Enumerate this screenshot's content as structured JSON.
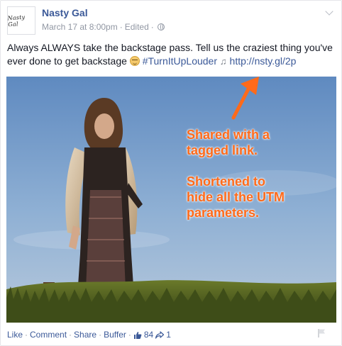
{
  "post": {
    "page_name": "Nasty Gal",
    "avatar_text": "Nasty Gal",
    "timestamp": "March 17 at 8:00pm",
    "edited_label": "Edited",
    "dot": "·",
    "text_main": "Always ALWAYS take the backstage pass. Tell us the craziest thing you've ever done to get backstage ",
    "hashtag": "#TurnItUpLouder",
    "music_note": "♫",
    "link": "http://nsty.gl/2p",
    "annotation": "Shared with a\ntagged link.\n\nShortened to\nhide all the UTM\nparameters."
  },
  "actions": {
    "like": "Like",
    "comment": "Comment",
    "share": "Share",
    "buffer": "Buffer",
    "likes_count": "84",
    "shares_count": "1",
    "sep": "·"
  },
  "icons": {
    "globe": "globe-icon",
    "chevron": "chevron-down-icon",
    "thumbs_up": "thumbs-up-icon",
    "share": "share-arrow-icon",
    "flag": "flag-icon",
    "emoji": "smiley-emoji-icon"
  },
  "colors": {
    "link": "#3b5998",
    "annotation": "#ff6a1a",
    "meta": "#9197a3"
  }
}
